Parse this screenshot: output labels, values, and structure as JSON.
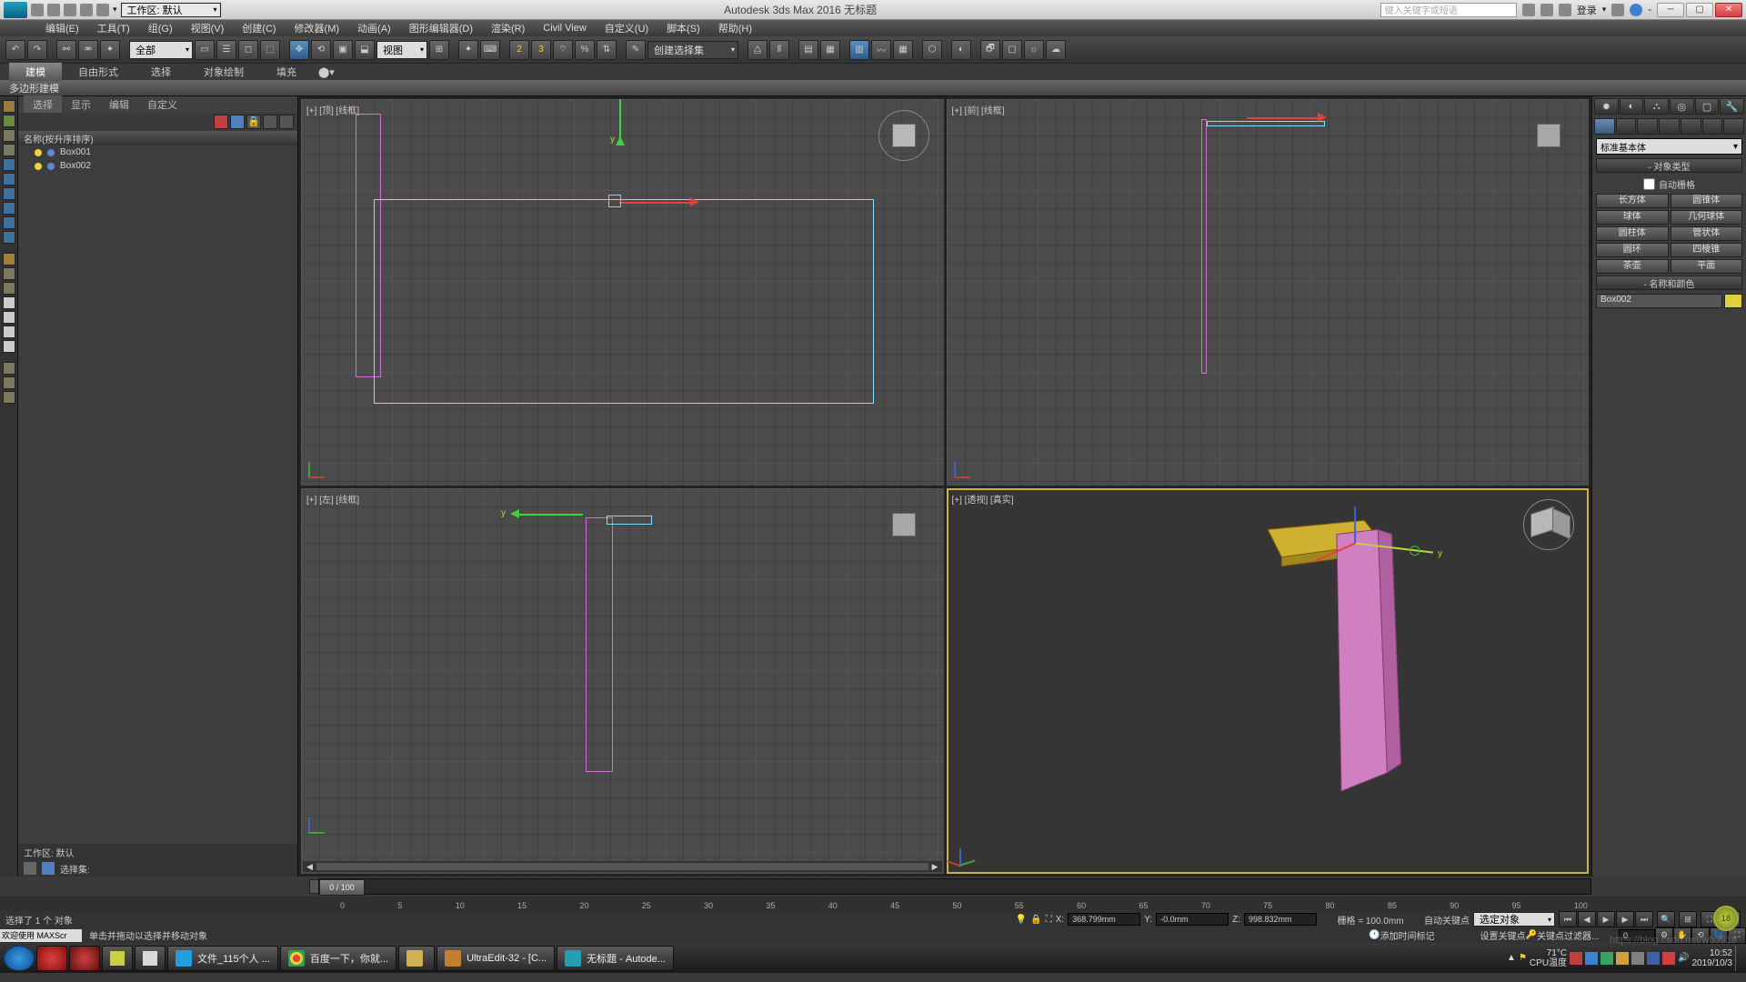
{
  "titlebar": {
    "workspace_label": "工作区: 默认",
    "title": "Autodesk 3ds Max 2016    无标题",
    "search_placeholder": "键入关键字或短语",
    "login": "登录"
  },
  "menubar": [
    "编辑(E)",
    "工具(T)",
    "组(G)",
    "视图(V)",
    "创建(C)",
    "修改器(M)",
    "动画(A)",
    "图形编辑器(D)",
    "渲染(R)",
    "Civil View",
    "自定义(U)",
    "脚本(S)",
    "帮助(H)"
  ],
  "toolbar": {
    "scope_dd": "全部",
    "view_dd": "视图",
    "selset_dd": "创建选择集"
  },
  "ribbon": {
    "tabs": [
      "建模",
      "自由形式",
      "选择",
      "对象绘制",
      "填充"
    ],
    "active": 0,
    "sub": "多边形建模"
  },
  "scene": {
    "tabs": [
      "选择",
      "显示",
      "编辑",
      "自定义"
    ],
    "header": "名称(按升序排序)",
    "items": [
      {
        "name": "Box001"
      },
      {
        "name": "Box002"
      }
    ],
    "workspace": "工作区: 默认",
    "selset_label": "选择集:"
  },
  "viewports": {
    "top": "[+] [顶] [线框]",
    "front": "[+] [前] [线框]",
    "left": "[+] [左] [线框]",
    "persp": "[+] [透视] [真实]"
  },
  "command": {
    "category": "标准基本体",
    "rollout_type": "对象类型",
    "autogrid": "自动栅格",
    "buttons": [
      "长方体",
      "圆锥体",
      "球体",
      "几何球体",
      "圆柱体",
      "管状体",
      "圆环",
      "四棱锥",
      "茶壶",
      "平面"
    ],
    "rollout_name": "名称和颜色",
    "obj_name": "Box002"
  },
  "timeline": {
    "slider": "0 / 100",
    "ticks": [
      "0",
      "5",
      "10",
      "15",
      "20",
      "25",
      "30",
      "35",
      "40",
      "45",
      "50",
      "55",
      "60",
      "65",
      "70",
      "75",
      "80",
      "85",
      "90",
      "95",
      "100"
    ]
  },
  "status": {
    "sel": "选择了 1 个 对象",
    "prompt": "单击并拖动以选择并移动对象",
    "x": "368.799mm",
    "y": "-0.0mm",
    "z": "998.832mm",
    "grid": "栅格 = 100.0mm",
    "addtime": "添加时间标记",
    "autokey": "自动关键点",
    "setkey": "设置关键点",
    "keymode": "选定对象",
    "filters": "关键点过滤器..."
  },
  "taskbar": {
    "items": [
      "文件_115个人 ...",
      "百度一下，你就...",
      "",
      "UltraEdit-32 - [C...",
      "无标题 - Autode..."
    ],
    "temp": "71°C",
    "cpu": "CPU温度",
    "time": "10:52",
    "date": "2019/10/3"
  }
}
